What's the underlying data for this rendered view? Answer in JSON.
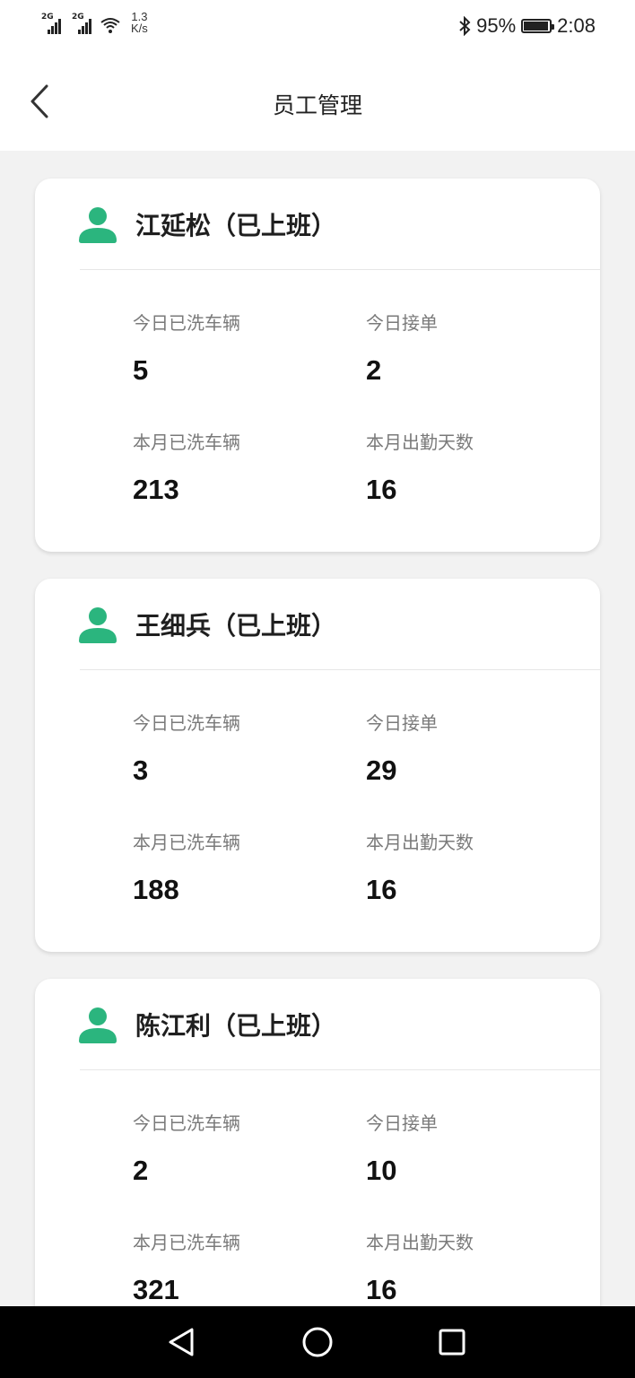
{
  "status_bar": {
    "signal1_tag": "2G",
    "signal2_tag": "2G",
    "speed_value": "1.3",
    "speed_unit": "K/s",
    "bluetooth_icon": "bluetooth-icon",
    "battery_percent": "95%",
    "battery_level": 0.95,
    "time": "2:08"
  },
  "header": {
    "title": "员工管理",
    "back_icon": "chevron-left-icon"
  },
  "labels": {
    "today_washed": "今日已洗车辆",
    "today_orders": "今日接单",
    "month_washed": "本月已洗车辆",
    "month_attendance": "本月出勤天数"
  },
  "employees": [
    {
      "name": "江延松（已上班）",
      "today_washed": "5",
      "today_orders": "2",
      "month_washed": "213",
      "month_attendance": "16"
    },
    {
      "name": "王细兵（已上班）",
      "today_washed": "3",
      "today_orders": "29",
      "month_washed": "188",
      "month_attendance": "16"
    },
    {
      "name": "陈江利（已上班）",
      "today_washed": "2",
      "today_orders": "10",
      "month_washed": "321",
      "month_attendance": "16"
    }
  ],
  "colors": {
    "accent": "#2bb57e",
    "background": "#f2f2f2",
    "card": "#ffffff"
  },
  "system_nav": {
    "back_icon": "triangle-back-icon",
    "home_icon": "circle-home-icon",
    "recents_icon": "square-recents-icon"
  }
}
